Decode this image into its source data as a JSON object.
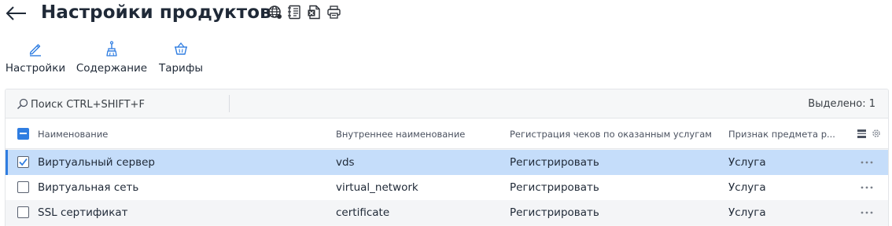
{
  "header": {
    "title": "Настройки продуктов",
    "icons": [
      "globe-icon",
      "document-list-icon",
      "excel-export-icon",
      "print-icon"
    ]
  },
  "tabs": [
    {
      "label": "Настройки",
      "icon": "pencil-icon"
    },
    {
      "label": "Содержание",
      "icon": "brush-icon"
    },
    {
      "label": "Тарифы",
      "icon": "basket-icon"
    }
  ],
  "search": {
    "placeholder": "Поиск CTRL+SHIFT+F",
    "value": ""
  },
  "selection": {
    "label": "Выделено: 1"
  },
  "table": {
    "columns": [
      "Наименование",
      "Внутреннее наименование",
      "Регистрация чеков по оказанным услугам",
      "Признак предмета р..."
    ],
    "rows": [
      {
        "name": "Виртуальный сервер",
        "internal": "vds",
        "registration": "Регистрировать",
        "subject": "Услуга",
        "selected": true
      },
      {
        "name": "Виртуальная сеть",
        "internal": "virtual_network",
        "registration": "Регистрировать",
        "subject": "Услуга",
        "selected": false
      },
      {
        "name": "SSL сертификат",
        "internal": "certificate",
        "registration": "Регистрировать",
        "subject": "Услуга",
        "selected": false
      }
    ]
  },
  "colors": {
    "accent": "#2f7de1",
    "selected_row": "#c5ddfa",
    "text": "#1f2937"
  }
}
